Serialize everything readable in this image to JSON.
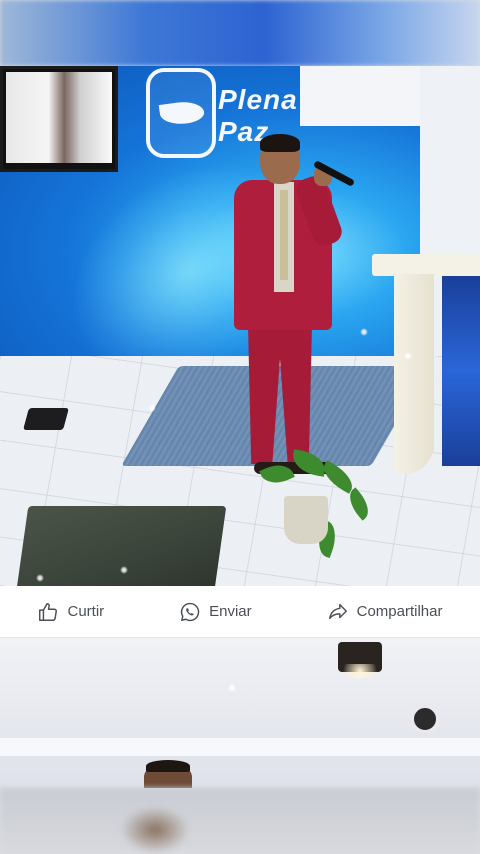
{
  "post": {
    "logo_text_line1": "Plena",
    "logo_text_line2": "Paz"
  },
  "actions": {
    "like_label": "Curtir",
    "send_label": "Enviar",
    "share_label": "Compartilhar"
  },
  "icons": {
    "like": "thumbs-up-icon",
    "send": "whatsapp-icon",
    "share": "share-arrow-icon"
  },
  "colors": {
    "action_text": "#4b4f56",
    "action_bar_bg": "#ffffff",
    "stage_blue": "#1574d8",
    "suit_red": "#b01e3d"
  }
}
